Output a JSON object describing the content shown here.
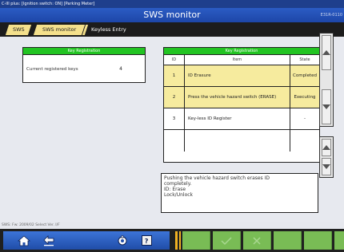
{
  "window": {
    "title": "C-III plus: [Ignition switch: ON] [Parking Meter]"
  },
  "header": {
    "title": "SWS monitor",
    "right_code": "E31R-0110"
  },
  "breadcrumb": {
    "items": [
      {
        "label": "SWS"
      },
      {
        "label": "SWS monitor"
      },
      {
        "label": "Keyless Entry"
      }
    ]
  },
  "left_panel": {
    "header": "Key Registration",
    "rows": [
      {
        "label": "Current registered keys",
        "value": "4"
      }
    ]
  },
  "right_panel": {
    "header": "Key Registration",
    "columns": [
      "ID",
      "Item",
      "State"
    ],
    "rows": [
      {
        "no": "1",
        "item": "ID Erasure",
        "state": "Completed",
        "highlighted": true
      },
      {
        "no": "2",
        "item": "Press the vehicle hazard switch (ERASE)",
        "state": "Executing",
        "highlighted": true
      },
      {
        "no": "3",
        "item": "Key-less ID Register",
        "state": "-",
        "highlighted": false
      },
      {
        "no": "",
        "item": "",
        "state": "",
        "highlighted": false
      }
    ]
  },
  "message": {
    "lines": [
      "Pushing the vehicle hazard switch erases ID",
      "completely.",
      "ID: Erase",
      "Lock/Unlock"
    ]
  },
  "status_bar": {
    "text": "SWS: Fw: 2009/02 Select Ver. I/F"
  },
  "toolbar": {
    "icons": [
      "home-icon",
      "back-icon",
      "gear-icon",
      "help-icon",
      "check-icon",
      "cross-icon"
    ]
  }
}
